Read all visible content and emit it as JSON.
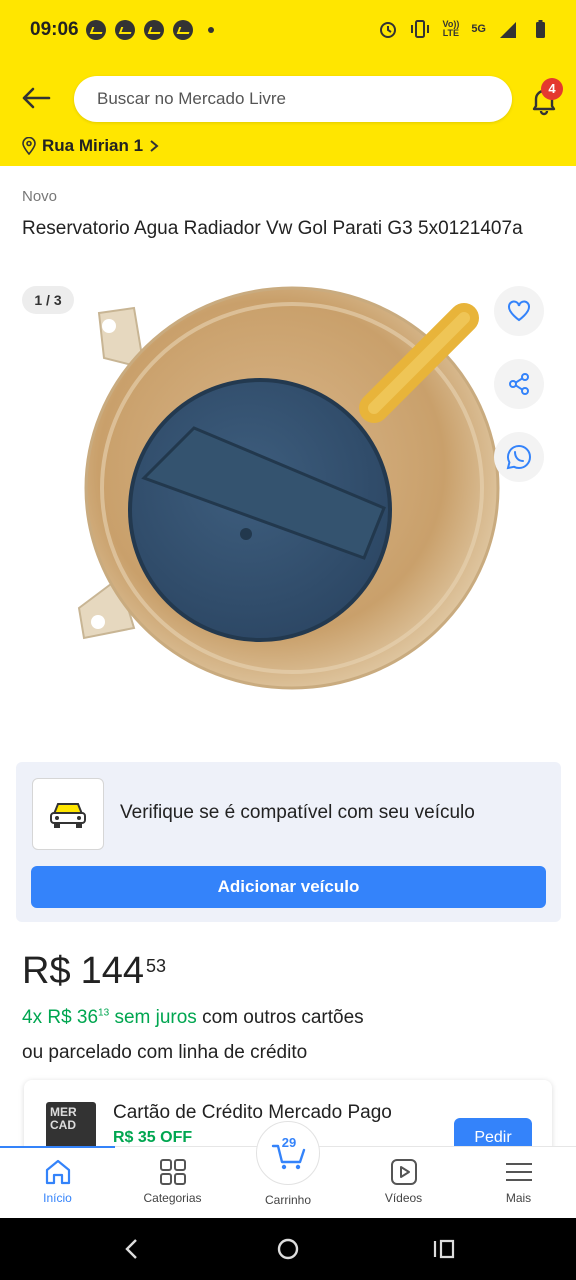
{
  "status_bar": {
    "time": "09:06",
    "network": "5G",
    "volte_line1": "Vo))",
    "volte_line2": "LTE"
  },
  "header": {
    "search_placeholder": "Buscar no Mercado Livre",
    "notifications_count": "4",
    "address": "Rua Mirian 1"
  },
  "product": {
    "condition": "Novo",
    "title": "Reservatorio Agua Radiador Vw Gol Parati G3 5x0121407a",
    "image_counter": "1 / 3"
  },
  "compatibility": {
    "text": "Verifique se é compatível com seu veículo",
    "button_label": "Adicionar veículo"
  },
  "price": {
    "currency": "R$",
    "amount": "144",
    "cents": "53",
    "installments_green": "4x R$ 36",
    "installments_cents": "13",
    "installments_interest": "sem juros",
    "installments_rest": "com outros cartões",
    "credit_line": "ou parcelado com linha de crédito"
  },
  "promo": {
    "card_text": "MER CAD",
    "title": "Cartão de Crédito Mercado Pago",
    "discount": "R$ 35 OFF",
    "button_label": "Pedir"
  },
  "bottom_nav": {
    "items": [
      {
        "label": "Início",
        "icon": "home-icon",
        "active": true
      },
      {
        "label": "Categorias",
        "icon": "grid-icon"
      },
      {
        "label": "Carrinho",
        "icon": "cart-icon",
        "badge": "29"
      },
      {
        "label": "Vídeos",
        "icon": "video-icon"
      },
      {
        "label": "Mais",
        "icon": "menu-icon"
      }
    ]
  },
  "colors": {
    "brand_yellow": "#ffe600",
    "accent_blue": "#3483fa",
    "green": "#00a650",
    "badge_red": "#e4392f"
  }
}
